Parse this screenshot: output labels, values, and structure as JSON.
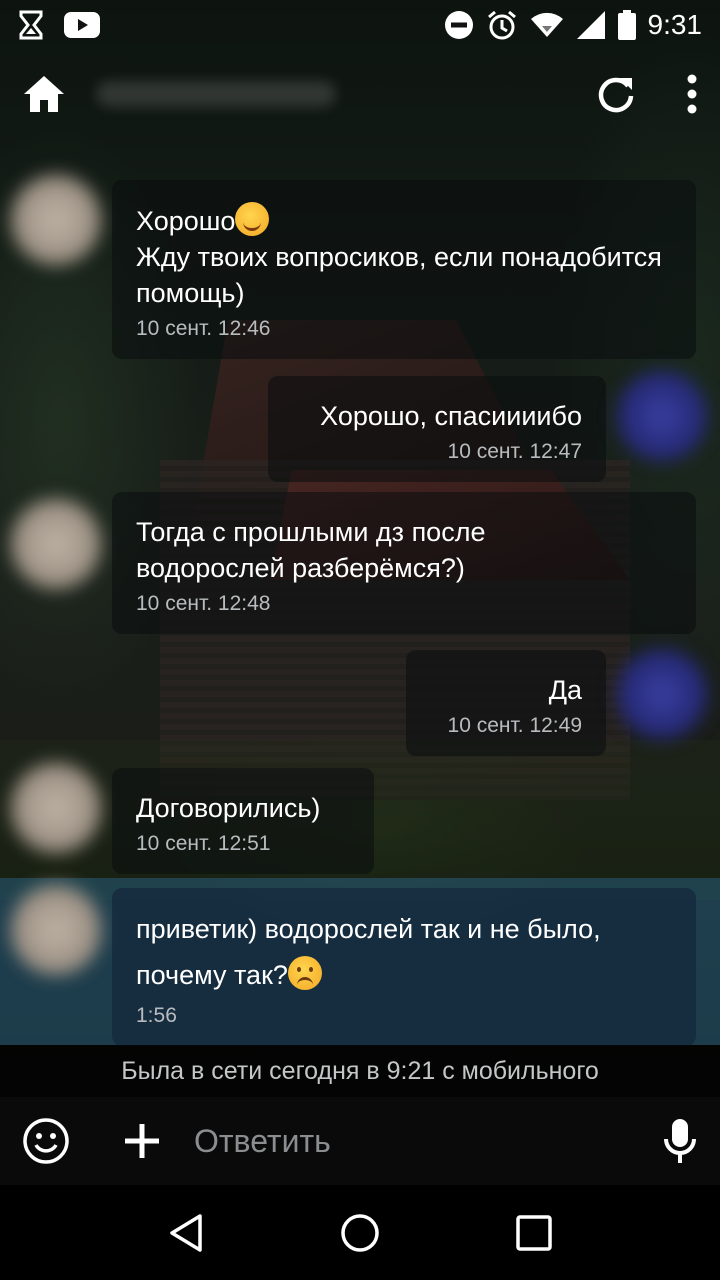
{
  "status_bar": {
    "time": "9:31",
    "icons": [
      "hourglass-icon",
      "youtube-icon",
      "do-not-disturb-icon",
      "alarm-icon",
      "wifi-icon",
      "signal-icon",
      "battery-icon"
    ]
  },
  "toolbar": {
    "icons": [
      "home-icon",
      "refresh-icon",
      "more-vertical-icon"
    ]
  },
  "messages": [
    {
      "direction": "in",
      "lines": [
        "Хорошо",
        "Жду твоих вопросиков, если понадобится помощь)"
      ],
      "emoji": "smiling-face-with-hearts",
      "time": "10 сент. 12:46"
    },
    {
      "direction": "out",
      "text": "Хорошо, спасиииибо",
      "time": "10 сент. 12:47"
    },
    {
      "direction": "in",
      "text": "Тогда с прошлыми дз после\nводорослей разберёмся?)",
      "time": "10 сент. 12:48"
    },
    {
      "direction": "out",
      "text": "Да",
      "time": "10 сент. 12:49"
    },
    {
      "direction": "in",
      "text": "Договорились)",
      "time": "10 сент. 12:51"
    },
    {
      "direction": "in",
      "text_before_emoji": "приветик) водорослей так и не было,\nпочему так?",
      "emoji": "frowning-face",
      "time": "1:56",
      "unread": true
    }
  ],
  "last_seen": "Была в сети сегодня в 9:21 с мобильного",
  "input": {
    "placeholder": "Ответить"
  },
  "colors": {
    "unread_highlight": "#2a5f7d",
    "timestamp": "#b9bcbf",
    "placeholder": "#8b8e91"
  },
  "nav_bar": {
    "icons": [
      "back-icon",
      "home-circle-icon",
      "recents-icon"
    ]
  }
}
